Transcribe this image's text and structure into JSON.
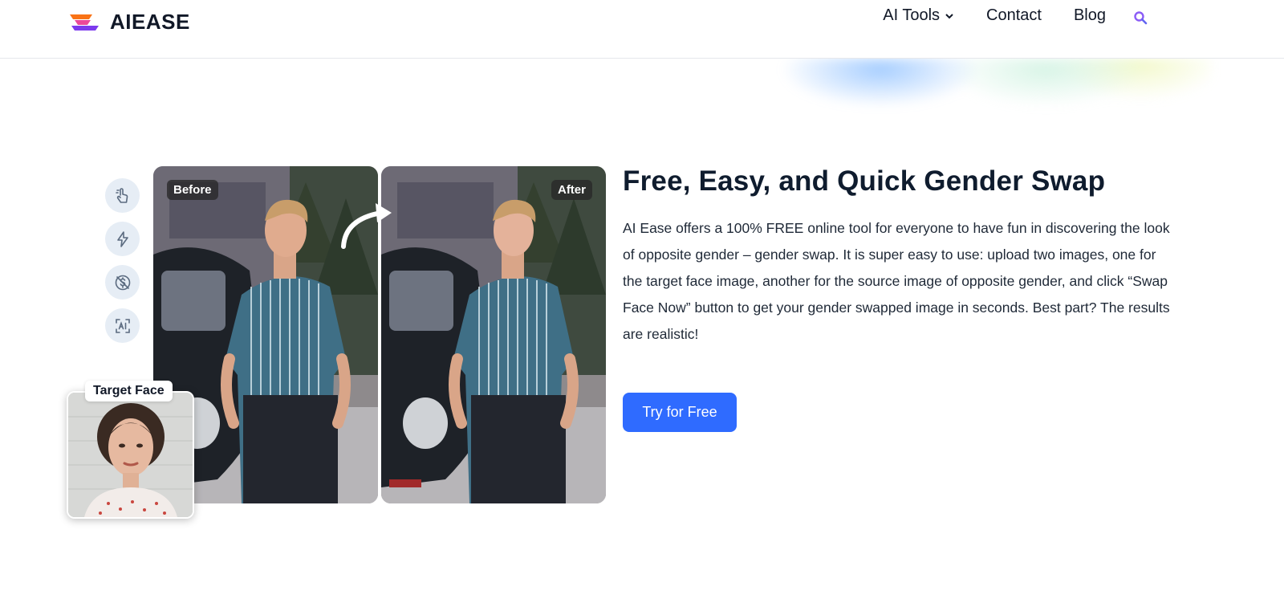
{
  "header": {
    "logo_text": "AIEASE",
    "nav": [
      {
        "label": "AI Tools",
        "has_dropdown": true
      },
      {
        "label": "Contact"
      },
      {
        "label": "Blog"
      }
    ],
    "search_icon": "search-icon"
  },
  "hero": {
    "before_tag": "Before",
    "after_tag": "After",
    "target_face_label": "Target Face",
    "feature_icons": [
      "tap-icon",
      "lightning-icon",
      "no-cost-icon",
      "ai-scan-icon"
    ],
    "headline": "Free, Easy, and Quick Gender Swap",
    "description": "AI Ease offers a 100% FREE online tool for everyone to have fun in discovering the look of opposite gender – gender swap. It is super easy to use: upload two images, one for the target face image, another for the source image of opposite gender, and click “Swap Face Now” button to get your gender swapped image in seconds. Best part? The results are realistic!",
    "cta_label": "Try for Free"
  },
  "colors": {
    "accent": "#2f6bff",
    "heading": "#0f1c2e",
    "icon_bg": "#e6edf5"
  }
}
